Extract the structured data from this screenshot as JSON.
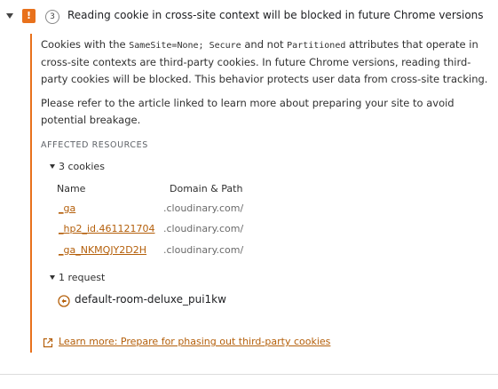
{
  "issue": {
    "severity_icon": "!",
    "count": "3",
    "title": "Reading cookie in cross-site context will be blocked in future Chrome versions"
  },
  "description": {
    "p1_part1": "Cookies with the ",
    "p1_code1": "SameSite=None; Secure",
    "p1_part2": " and not ",
    "p1_code2": "Partitioned",
    "p1_part3": " attributes that operate in cross-site contexts are third-party cookies. In future Chrome versions, reading third-party cookies will be blocked. This behavior protects user data from cross-site tracking.",
    "p2": "Please refer to the article linked to learn more about preparing your site to avoid potential breakage."
  },
  "affected": {
    "heading": "AFFECTED RESOURCES",
    "cookies_label": "3 cookies",
    "col_name": "Name",
    "col_domain": "Domain & Path",
    "cookies": [
      {
        "name": "_ga",
        "domain": ".cloudinary.com/"
      },
      {
        "name": "_hp2_id.461121704",
        "domain": ".cloudinary.com/"
      },
      {
        "name": "_ga_NKMQJY2D2H",
        "domain": ".cloudinary.com/"
      }
    ],
    "requests_label": "1 request",
    "requests": [
      {
        "name": "default-room-deluxe_pui1kw"
      }
    ]
  },
  "learn_more": {
    "label": "Learn more: Prepare for phasing out third-party cookies"
  },
  "colors": {
    "accent": "#e8711c",
    "link": "#b45f0a"
  }
}
